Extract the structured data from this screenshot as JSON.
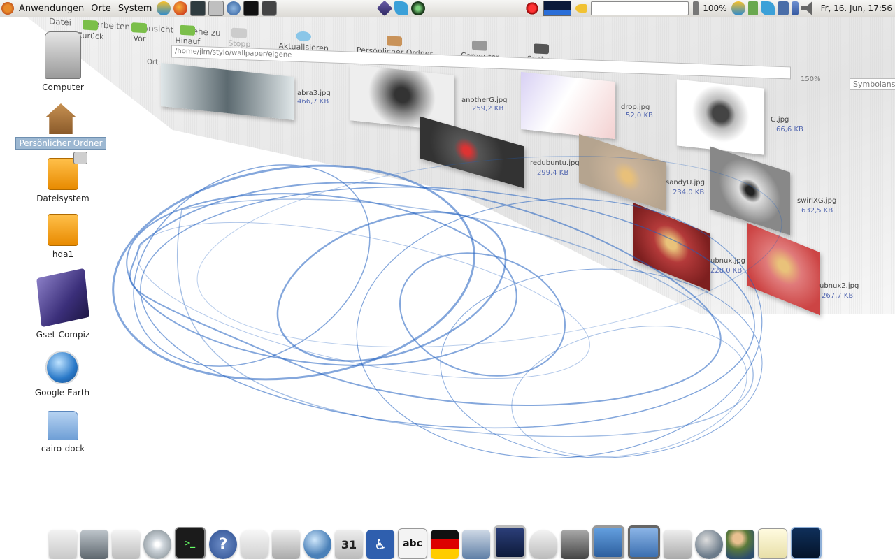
{
  "top_panel": {
    "menu": [
      "Anwendungen",
      "Orte",
      "System"
    ],
    "battery": "100%",
    "clock": "Fr, 16. Jun, 17:56"
  },
  "desktop": {
    "icons": [
      {
        "label": "Computer",
        "icon": "computer-icon"
      },
      {
        "label": "Persönlicher Ordner",
        "icon": "home-folder-icon",
        "selected": true
      },
      {
        "label": "Dateisystem",
        "icon": "drive-icon"
      },
      {
        "label": "hda1",
        "icon": "drive-icon"
      },
      {
        "label": "Gset-Compiz",
        "icon": "compiz-cube-icon"
      },
      {
        "label": "Google Earth",
        "icon": "globe-icon"
      },
      {
        "label": "cairo-dock",
        "icon": "folder-icon"
      }
    ]
  },
  "file_manager": {
    "menubar": [
      "Datei",
      "Bearbeiten",
      "Ansicht",
      "Gehe zu"
    ],
    "toolbar": [
      "Zurück",
      "Vor",
      "Hinauf",
      "Stopp",
      "Aktualisieren",
      "Persönlicher Ordner",
      "Computer",
      "Suchen"
    ],
    "location_label": "Ort:",
    "location_path": "/home/jlm/stylo/wallpaper/eigene",
    "zoom": "150%",
    "view_mode": "Symbolansicht",
    "files": [
      {
        "name": "abra3.jpg",
        "size": "466,7 KB"
      },
      {
        "name": "anotherG.jpg",
        "size": "259,2 KB"
      },
      {
        "name": "drop.jpg",
        "size": "52,0 KB"
      },
      {
        "name": "G.jpg",
        "size": "66,6 KB"
      },
      {
        "name": "redubuntu.jpg",
        "size": "299,4 KB"
      },
      {
        "name": "sandyU.jpg",
        "size": "234,0 KB"
      },
      {
        "name": "swirlXG.jpg",
        "size": "632,5 KB"
      },
      {
        "name": "ubnux.jpg",
        "size": "228,0 KB"
      },
      {
        "name": "ubnux2.jpg",
        "size": "267,7 KB"
      }
    ]
  },
  "dock": {
    "items": [
      "text-editor-icon",
      "camera-icon",
      "mail-icon",
      "cd-icon",
      "terminal-icon",
      "help-icon",
      "chat-icon",
      "news-icon",
      "globe-icon",
      "calendar-icon",
      "accessibility-icon",
      "spellcheck-icon",
      "keyboard-layout-icon",
      "network-icon",
      "screensaver-icon",
      "mouse-icon",
      "sound-icon",
      "display-icon",
      "remote-desktop-icon",
      "media-player-icon",
      "network-globe-icon",
      "users-icon",
      "notes-icon",
      "system-monitor-icon"
    ],
    "calendar_day": "31",
    "spell_text": "abc"
  },
  "colors": {
    "desktop_bg": "#ffffff",
    "swirl": "#1f5fbf",
    "selection": "#9db8d2",
    "size_text": "#5468b0"
  }
}
